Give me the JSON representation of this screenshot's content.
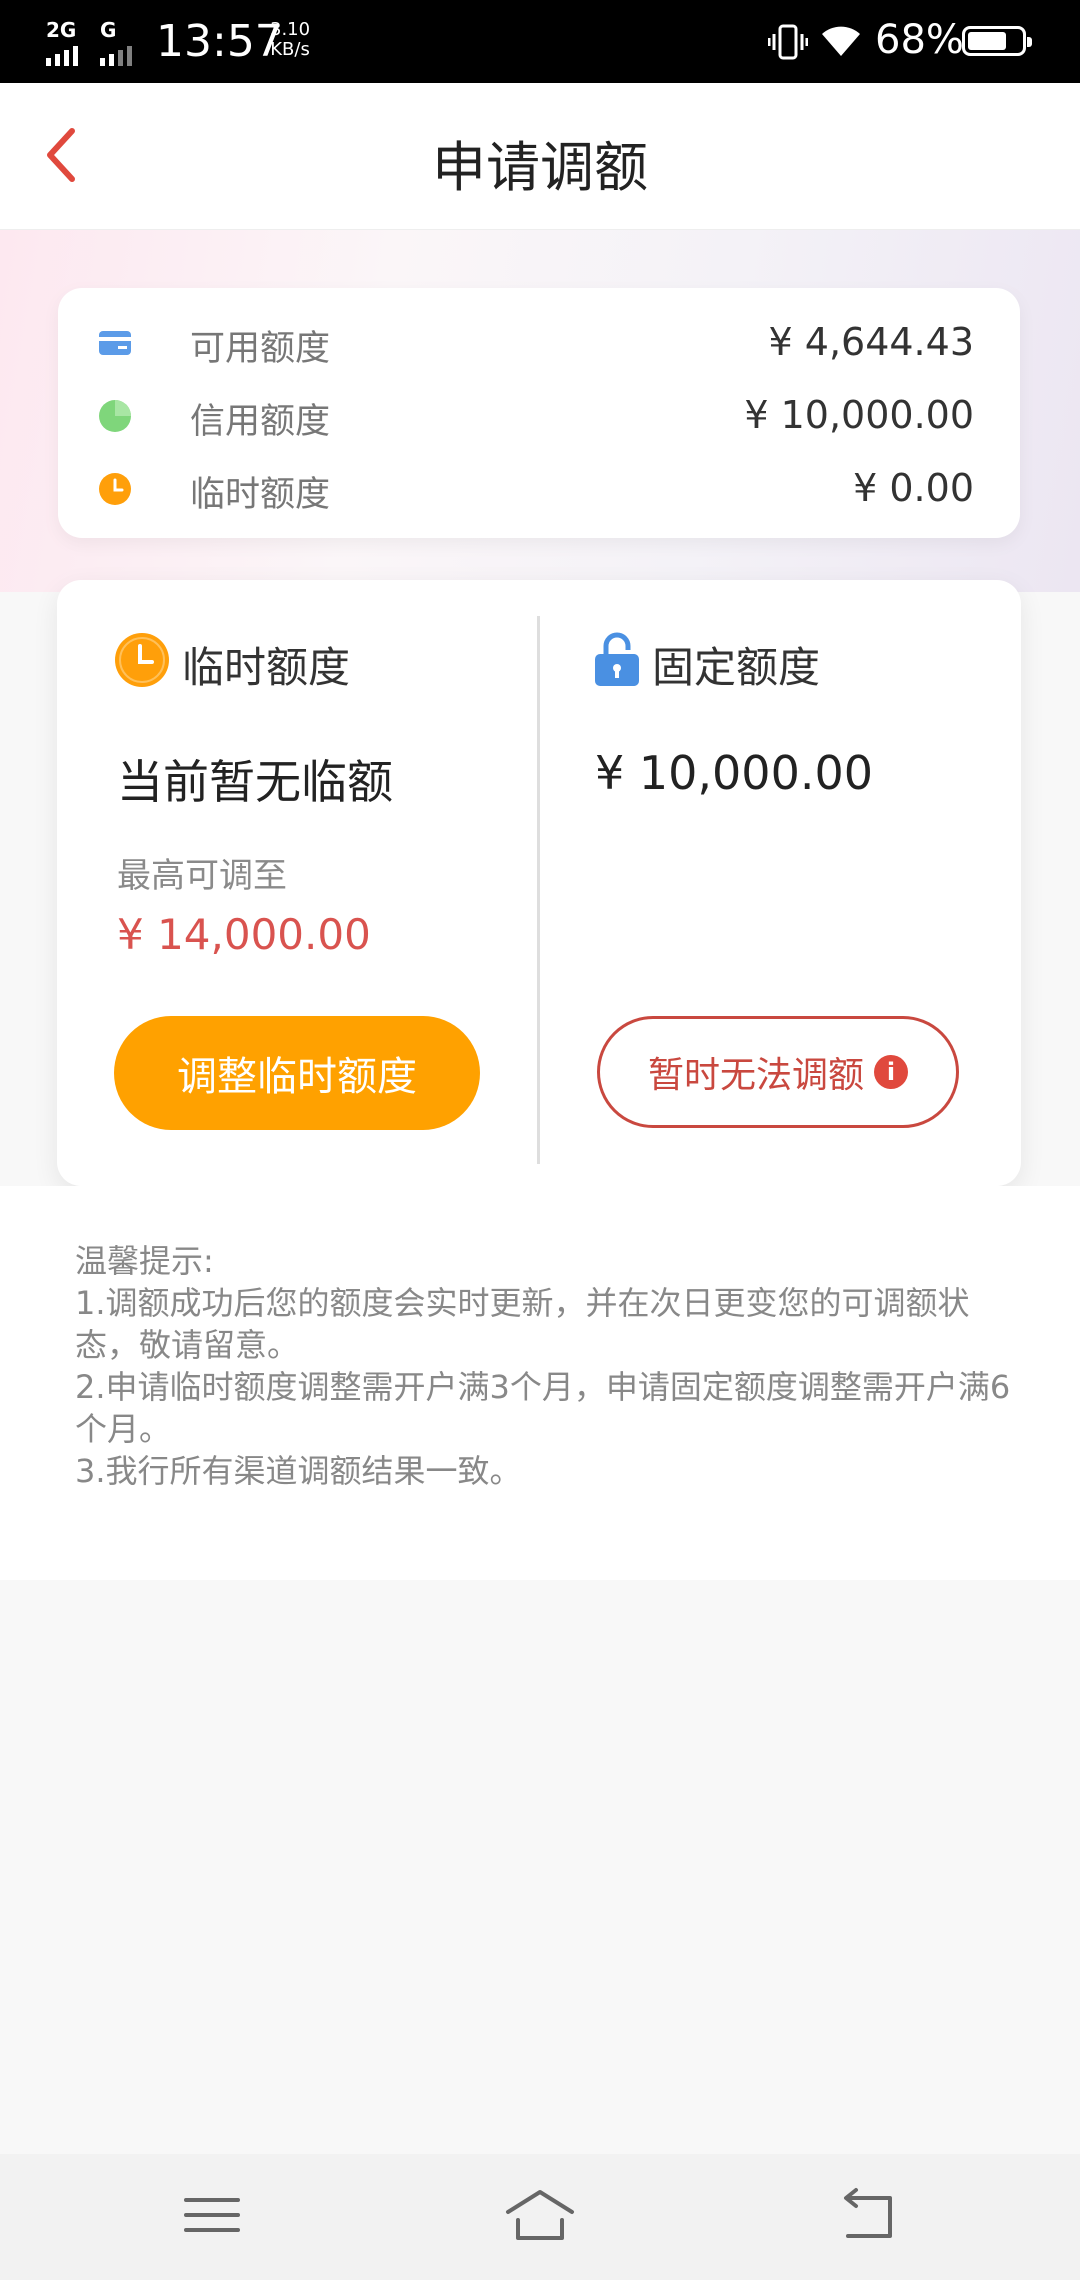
{
  "status_bar": {
    "network1": "2G",
    "network2": "G",
    "time": "13:57",
    "speed_value": "3.10",
    "speed_unit": "KB/s",
    "battery": "68%",
    "battery_level": 0.68
  },
  "header": {
    "title": "申请调额"
  },
  "summary": {
    "rows": [
      {
        "label": "可用额度",
        "value": "¥ 4,644.43",
        "icon": "card-icon",
        "color": "#5b9be8"
      },
      {
        "label": "信用额度",
        "value": "¥ 10,000.00",
        "icon": "pie-icon",
        "color": "#7fd67b"
      },
      {
        "label": "临时额度",
        "value": "¥ 0.00",
        "icon": "clock-icon",
        "color": "#ff9f0a"
      }
    ]
  },
  "temporary": {
    "title": "临时额度",
    "status": "当前暂无临额",
    "max_label": "最高可调至",
    "max_value": "¥ 14,000.00",
    "button": "调整临时额度"
  },
  "fixed": {
    "title": "固定额度",
    "value": "¥ 10,000.00",
    "button": "暂时无法调额"
  },
  "tips": {
    "title": "温馨提示:",
    "line1": "1.调额成功后您的额度会实时更新，并在次日更变您的可调额状态，敬请留意。",
    "line2": "2.申请临时额度调整需开户满3个月，申请固定额度调整需开户满6个月。",
    "line3": "3.我行所有渠道调额结果一致。"
  },
  "colors": {
    "accent_orange": "#ffa100",
    "accent_red": "#c9483f",
    "back_arrow": "#e0493d"
  }
}
